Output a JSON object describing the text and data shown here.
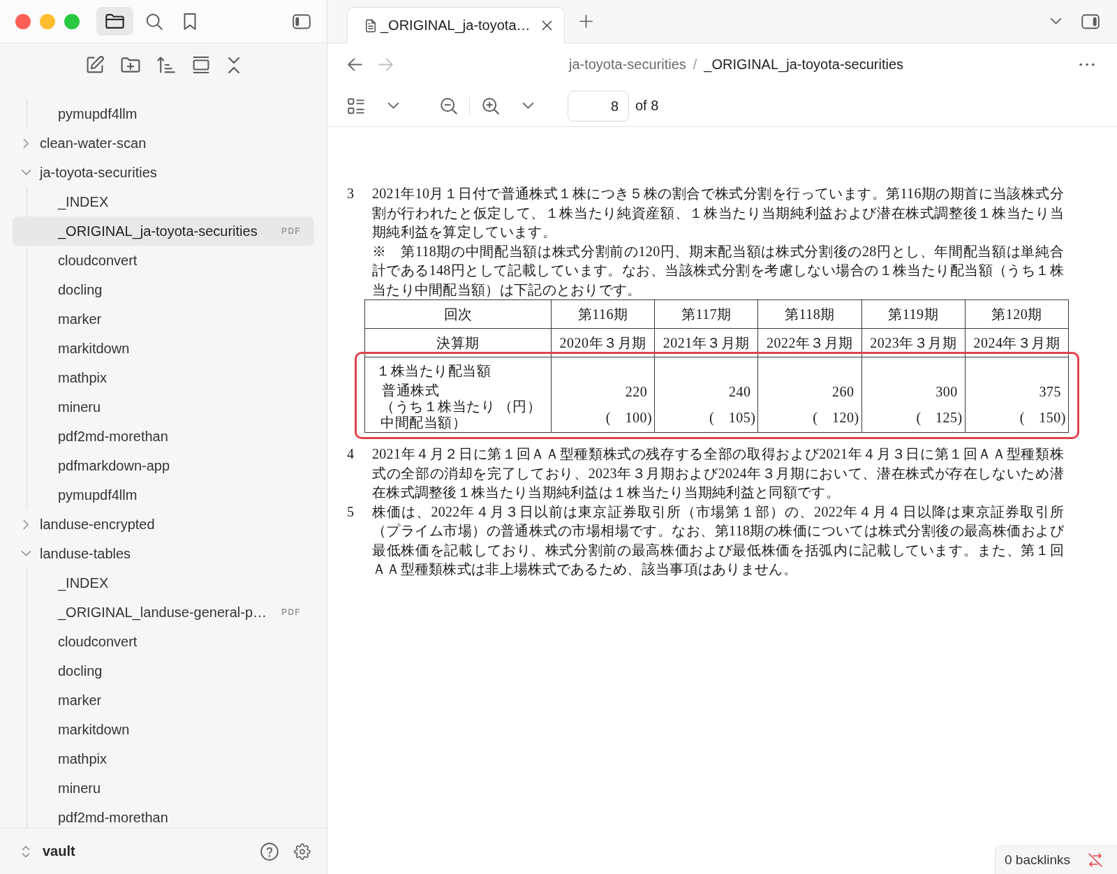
{
  "sidebar_tabs": [
    {
      "kind": "files",
      "selected": true
    },
    {
      "kind": "search",
      "selected": false
    },
    {
      "kind": "bookmarks",
      "selected": false
    }
  ],
  "tree": [
    {
      "kind": "continued",
      "children": [
        {
          "kind": "file",
          "label": "pymupdf4llm",
          "selected": false
        }
      ]
    },
    {
      "kind": "folder",
      "label": "clean-water-scan",
      "expanded": false,
      "selected": false
    },
    {
      "kind": "folder",
      "label": "ja-toyota-securities",
      "expanded": true,
      "selected": false,
      "children": [
        {
          "kind": "file",
          "label": "_INDEX",
          "selected": false
        },
        {
          "kind": "file",
          "label": "_ORIGINAL_ja-toyota-securities",
          "badge": "PDF",
          "selected": true
        },
        {
          "kind": "file",
          "label": "cloudconvert",
          "selected": false
        },
        {
          "kind": "file",
          "label": "docling",
          "selected": false
        },
        {
          "kind": "file",
          "label": "marker",
          "selected": false
        },
        {
          "kind": "file",
          "label": "markitdown",
          "selected": false
        },
        {
          "kind": "file",
          "label": "mathpix",
          "selected": false
        },
        {
          "kind": "file",
          "label": "mineru",
          "selected": false
        },
        {
          "kind": "file",
          "label": "pdf2md-morethan",
          "selected": false
        },
        {
          "kind": "file",
          "label": "pdfmarkdown-app",
          "selected": false
        },
        {
          "kind": "file",
          "label": "pymupdf4llm",
          "selected": false
        }
      ]
    },
    {
      "kind": "folder",
      "label": "landuse-encrypted",
      "expanded": false,
      "selected": false
    },
    {
      "kind": "folder",
      "label": "landuse-tables",
      "expanded": true,
      "selected": false,
      "children": [
        {
          "kind": "file",
          "label": "_INDEX",
          "selected": false
        },
        {
          "kind": "file",
          "label": "_ORIGINAL_landuse-general-p…",
          "badge": "PDF",
          "selected": false
        },
        {
          "kind": "file",
          "label": "cloudconvert",
          "selected": false
        },
        {
          "kind": "file",
          "label": "docling",
          "selected": false
        },
        {
          "kind": "file",
          "label": "marker",
          "selected": false
        },
        {
          "kind": "file",
          "label": "markitdown",
          "selected": false
        },
        {
          "kind": "file",
          "label": "mathpix",
          "selected": false
        },
        {
          "kind": "file",
          "label": "mineru",
          "selected": false
        },
        {
          "kind": "file",
          "label": "pdf2md-morethan",
          "selected": false
        }
      ]
    }
  ],
  "vault": {
    "name": "vault"
  },
  "tabs": [
    {
      "title": "_ORIGINAL_ja-toyota…",
      "selected": true
    }
  ],
  "navigation": {
    "back": {
      "disabled": false
    },
    "forward": {
      "disabled": true
    }
  },
  "breadcrumb": {
    "parts": [
      "ja-toyota-securities",
      "_ORIGINAL_ja-toyota-securities"
    ],
    "separator": "/"
  },
  "pdf_toolbar": {
    "page": "8",
    "page_count": "of 8"
  },
  "document": {
    "notes": [
      {
        "number": "3",
        "paragraphs": [
          "2021年10月１日付で普通株式１株につき５株の割合で株式分割を行っています。第116期の期首に当該株式分割が行われたと仮定して、１株当たり純資産額、１株当たり当期純利益および潜在株式調整後１株当たり当期純利益を算定しています。",
          "※　第118期の中間配当額は株式分割前の120円、期末配当額は株式分割後の28円とし、年間配当額は単純合計である148円として記載しています。なお、当該株式分割を考慮しない場合の１株当たり配当額（うち１株当たり中間配当額）は下記のとおりです。"
        ],
        "table": {
          "columns": [
            "回次",
            "第116期",
            "第117期",
            "第118期",
            "第119期",
            "第120期"
          ],
          "rows": [
            {
              "kind": "text",
              "highlighted": false,
              "cells": [
                "決算期",
                "2020年３月期",
                "2021年３月期",
                "2022年３月期",
                "2023年３月期",
                "2024年３月期"
              ]
            },
            {
              "kind": "dividend",
              "highlighted": true,
              "label": "１株当たり配当額",
              "sublabel": "普通株式",
              "note": "（うち１株当たり中間配当額）",
              "unit": "（円）",
              "values": [
                {
                  "value": "220",
                  "interim": "(　100)"
                },
                {
                  "value": "240",
                  "interim": "(　105)"
                },
                {
                  "value": "260",
                  "interim": "(　120)"
                },
                {
                  "value": "300",
                  "interim": "(　125)"
                },
                {
                  "value": "375",
                  "interim": "(　150)"
                }
              ]
            }
          ]
        }
      },
      {
        "number": "4",
        "paragraphs": [
          "2021年４月２日に第１回ＡＡ型種類株式の残存する全部の取得および2021年４月３日に第１回ＡＡ型種類株式の全部の消却を完了しており、2023年３月期および2024年３月期において、潜在株式が存在しないため潜在株式調整後１株当たり当期純利益は１株当たり当期純利益と同額です。"
        ]
      },
      {
        "number": "5",
        "paragraphs": [
          "株価は、2022年４月３日以前は東京証券取引所（市場第１部）の、2022年４月４日以降は東京証券取引所（プライム市場）の普通株式の市場相場です。なお、第118期の株価については株式分割後の最高株価および最低株価を記載しており、株式分割前の最高株価および最低株価を括弧内に記載しています。また、第１回ＡＡ型種類株式は非上場株式であるため、該当事項はありません。"
        ]
      }
    ]
  },
  "status_bar": {
    "backlinks": "0 backlinks"
  }
}
